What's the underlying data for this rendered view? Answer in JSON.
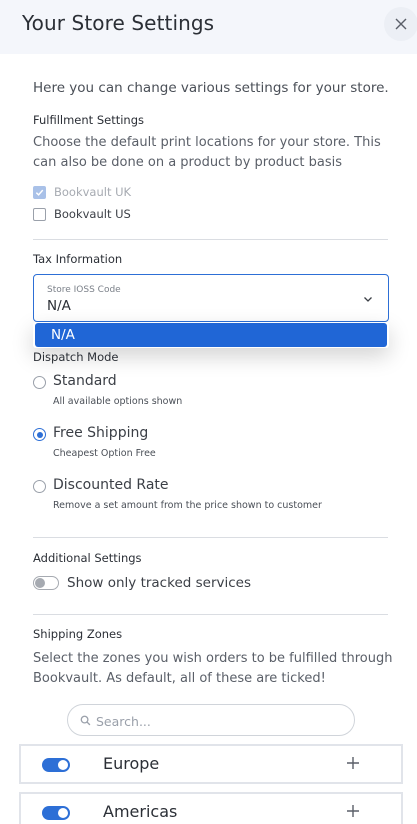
{
  "header": {
    "title": "Your Store Settings",
    "close_icon": "close-icon"
  },
  "intro": "Here you can change various settings for your store.",
  "fulfillment": {
    "title": "Fulfillment Settings",
    "description": "Choose the default print locations for your store. This can also be done on a product by product basis",
    "options": [
      {
        "label": "Bookvault UK",
        "checked": true,
        "disabled": true
      },
      {
        "label": "Bookvault US",
        "checked": false,
        "disabled": false
      }
    ]
  },
  "tax": {
    "title": "Tax Information",
    "field_label": "Store IOSS Code",
    "value": "N/A",
    "dropdown_options": [
      "N/A"
    ]
  },
  "dispatch": {
    "title": "Dispatch Mode",
    "options": [
      {
        "label": "Standard",
        "sub": "All available options shown",
        "checked": false
      },
      {
        "label": "Free Shipping",
        "sub": "Cheapest Option Free",
        "checked": true
      },
      {
        "label": "Discounted Rate",
        "sub": "Remove a set amount from the price shown to customer",
        "checked": false
      }
    ]
  },
  "additional": {
    "title": "Additional Settings",
    "toggle_label": "Show only tracked services",
    "toggle_on": false
  },
  "shipping_zones": {
    "title": "Shipping Zones",
    "description": "Select the zones you wish orders to be fulfilled through Bookvault. As default, all of these are ticked!",
    "search_placeholder": "Search...",
    "zones": [
      {
        "name": "Europe",
        "enabled": true
      },
      {
        "name": "Americas",
        "enabled": true
      }
    ]
  },
  "colors": {
    "accent": "#2d6fd6",
    "header_bg": "#f4f6fb",
    "dropdown_highlight": "#2066d6"
  }
}
